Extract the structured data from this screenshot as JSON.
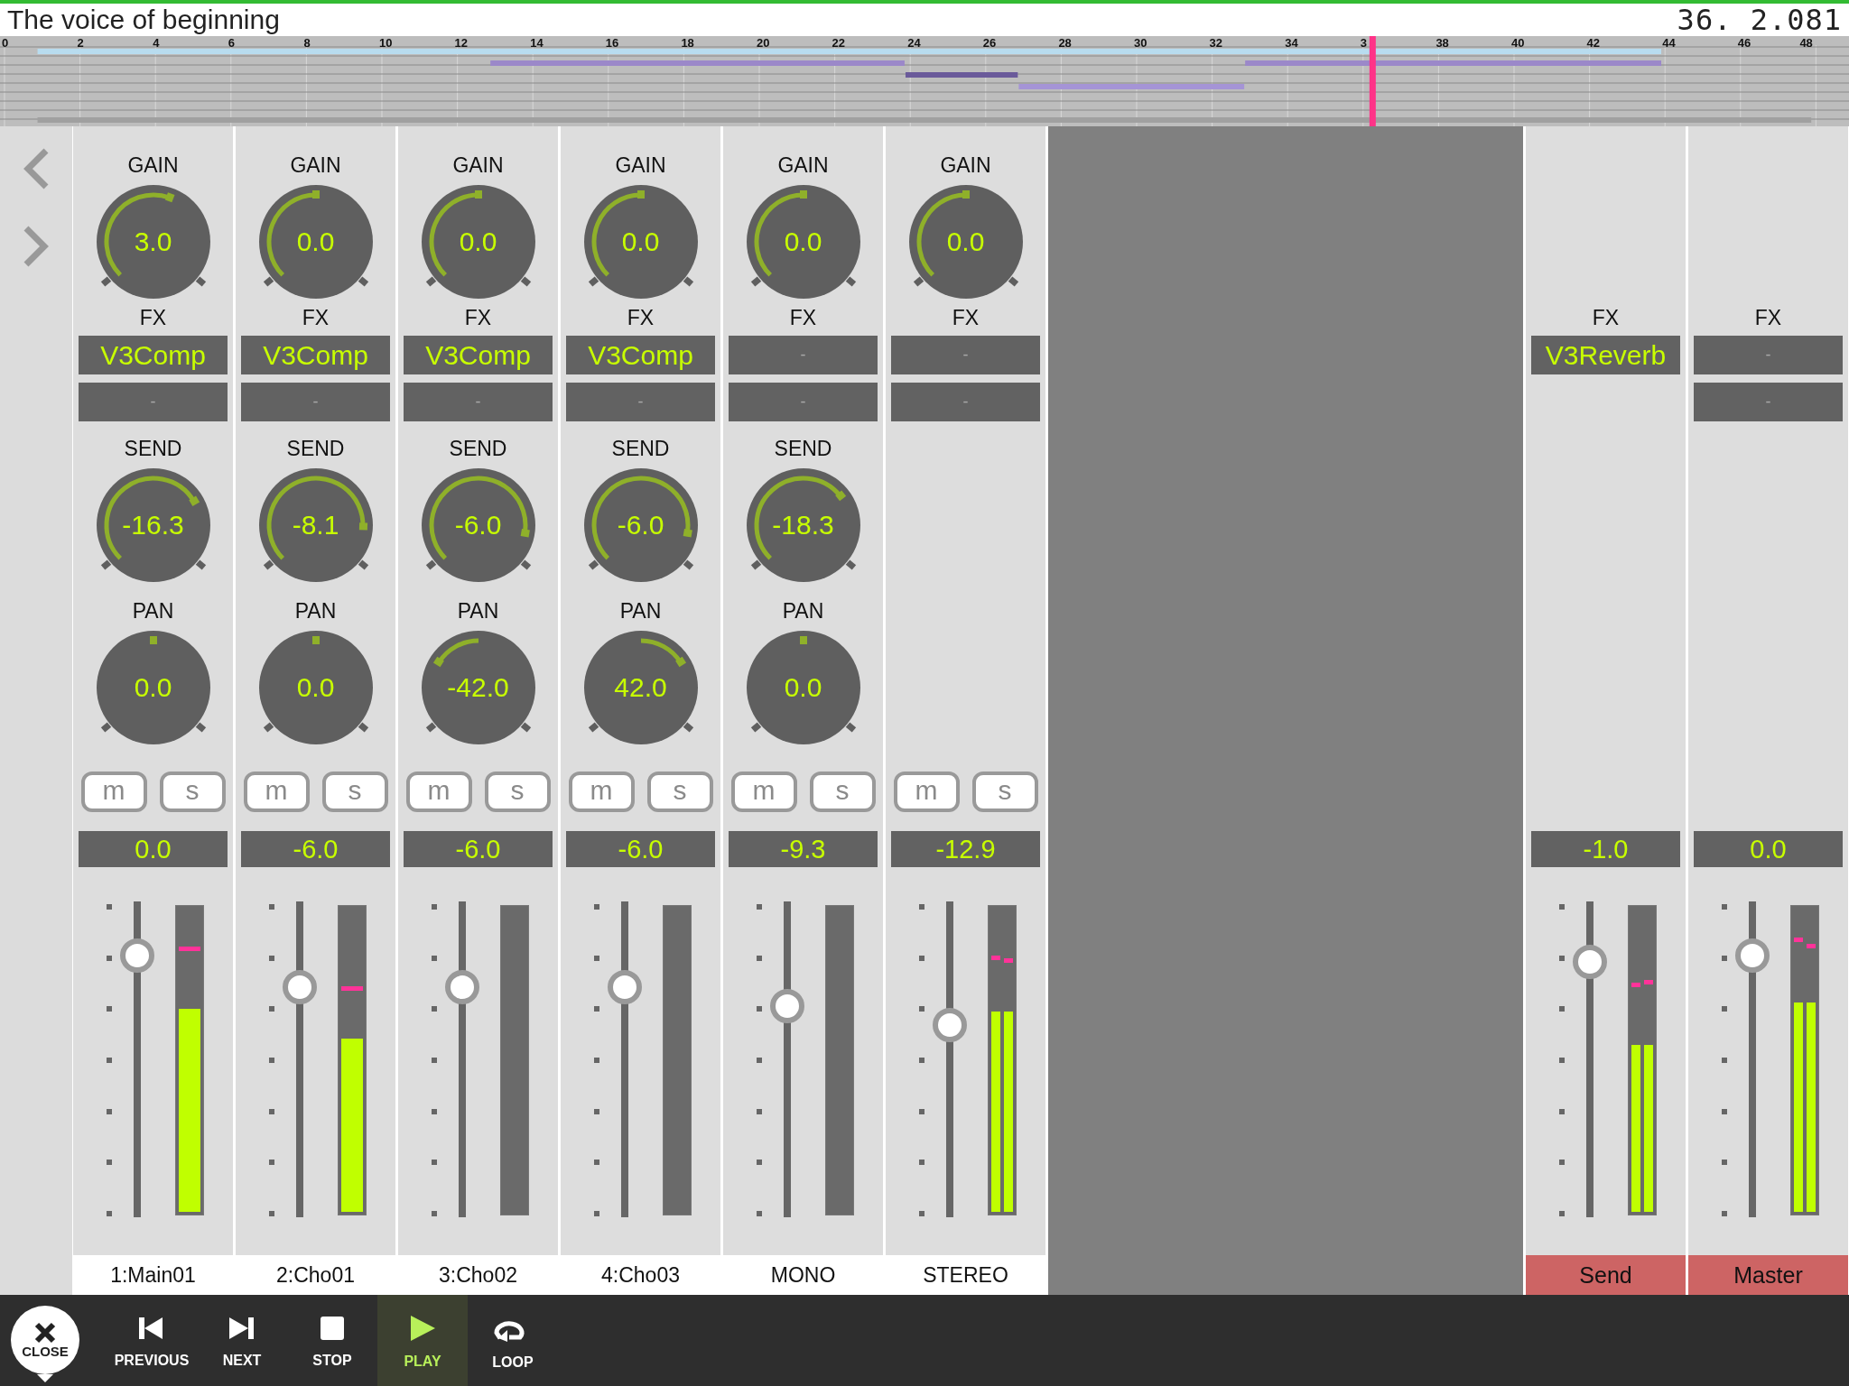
{
  "title": "The voice of beginning",
  "position": "36. 2.081",
  "timeline": {
    "ruler": [
      "0",
      "2",
      "4",
      "6",
      "8",
      "10",
      "12",
      "14",
      "16",
      "18",
      "20",
      "22",
      "24",
      "26",
      "28",
      "30",
      "32",
      "34",
      "3",
      "38",
      "40",
      "42",
      "44",
      "46",
      "48"
    ],
    "playhead": {
      "level": 0.755
    }
  },
  "strips": [
    {
      "name": "1:Main01",
      "kind": "track",
      "gain": {
        "label": "GAIN",
        "value": "3.0"
      },
      "fx_label": "FX",
      "fx": [
        {
          "value": "V3Comp",
          "assigned": true
        },
        {
          "value": "-",
          "assigned": false
        }
      ],
      "send": {
        "label": "SEND",
        "value": "-16.3"
      },
      "pan": {
        "label": "PAN",
        "value": "0.0"
      },
      "mute": {
        "label": "m",
        "on": false
      },
      "solo": {
        "label": "s",
        "on": false
      },
      "volume": "0.0",
      "fader": {
        "level": 0.83
      },
      "meter": [
        {
          "level": 0.67,
          "peak": {
            "level": 0.86
          }
        }
      ]
    },
    {
      "name": "2:Cho01",
      "kind": "track",
      "gain": {
        "label": "GAIN",
        "value": "0.0"
      },
      "fx_label": "FX",
      "fx": [
        {
          "value": "V3Comp",
          "assigned": true
        },
        {
          "value": "-",
          "assigned": false
        }
      ],
      "send": {
        "label": "SEND",
        "value": "-8.1"
      },
      "pan": {
        "label": "PAN",
        "value": "0.0"
      },
      "mute": {
        "label": "m",
        "on": false
      },
      "solo": {
        "label": "s",
        "on": false
      },
      "volume": "-6.0",
      "fader": {
        "level": 0.73
      },
      "meter": [
        {
          "level": 0.57,
          "peak": {
            "level": 0.73
          }
        }
      ]
    },
    {
      "name": "3:Cho02",
      "kind": "track",
      "gain": {
        "label": "GAIN",
        "value": "0.0"
      },
      "fx_label": "FX",
      "fx": [
        {
          "value": "V3Comp",
          "assigned": true
        },
        {
          "value": "-",
          "assigned": false
        }
      ],
      "send": {
        "label": "SEND",
        "value": "-6.0"
      },
      "pan": {
        "label": "PAN",
        "value": "-42.0"
      },
      "mute": {
        "label": "m",
        "on": false
      },
      "solo": {
        "label": "s",
        "on": false
      },
      "volume": "-6.0",
      "fader": {
        "level": 0.73
      }
    },
    {
      "name": "4:Cho03",
      "kind": "track",
      "gain": {
        "label": "GAIN",
        "value": "0.0"
      },
      "fx_label": "FX",
      "fx": [
        {
          "value": "V3Comp",
          "assigned": true
        },
        {
          "value": "-",
          "assigned": false
        }
      ],
      "send": {
        "label": "SEND",
        "value": "-6.0"
      },
      "pan": {
        "label": "PAN",
        "value": "42.0"
      },
      "mute": {
        "label": "m",
        "on": false
      },
      "solo": {
        "label": "s",
        "on": false
      },
      "volume": "-6.0",
      "fader": {
        "level": 0.73
      }
    },
    {
      "name": "MONO",
      "kind": "track",
      "gain": {
        "label": "GAIN",
        "value": "0.0"
      },
      "fx_label": "FX",
      "fx": [
        {
          "value": "-",
          "assigned": false
        },
        {
          "value": "-",
          "assigned": false
        }
      ],
      "send": {
        "label": "SEND",
        "value": "-18.3"
      },
      "pan": {
        "label": "PAN",
        "value": "0.0"
      },
      "mute": {
        "label": "m",
        "on": false
      },
      "solo": {
        "label": "s",
        "on": false
      },
      "volume": "-9.3",
      "fader": {
        "level": 0.67
      }
    },
    {
      "name": "STEREO",
      "kind": "track",
      "gain": {
        "label": "GAIN",
        "value": "0.0"
      },
      "fx_label": "FX",
      "fx": [
        {
          "value": "-",
          "assigned": false
        },
        {
          "value": "-",
          "assigned": false
        }
      ],
      "mute": {
        "label": "m",
        "on": false
      },
      "solo": {
        "label": "s",
        "on": false
      },
      "volume": "-12.9",
      "fader": {
        "level": 0.61
      },
      "meter": [
        {
          "level": 0.66,
          "peak": {
            "level": 0.83
          }
        },
        {
          "level": 0.66,
          "peak": {
            "level": 0.82
          }
        }
      ]
    }
  ],
  "buses": [
    {
      "name": "Send",
      "kind": "bus",
      "fx_label": "FX",
      "fx": [
        {
          "value": "V3Reverb",
          "assigned": true
        }
      ],
      "volume": "-1.0",
      "fader": {
        "level": 0.81
      },
      "meter": [
        {
          "level": 0.55,
          "peak": {
            "level": 0.74
          }
        },
        {
          "level": 0.55,
          "peak": {
            "level": 0.75
          }
        }
      ]
    },
    {
      "name": "Master",
      "kind": "bus",
      "fx_label": "FX",
      "fx": [
        {
          "value": "-",
          "assigned": false
        },
        {
          "value": "-",
          "assigned": false
        }
      ],
      "volume": "0.0",
      "fader": {
        "level": 0.83
      },
      "meter": [
        {
          "level": 0.69,
          "peak": {
            "level": 0.89
          }
        },
        {
          "level": 0.69,
          "peak": {
            "level": 0.87
          }
        }
      ]
    }
  ],
  "close": {
    "label": "CLOSE"
  },
  "transport": [
    {
      "kind": "previous",
      "label": "PREVIOUS",
      "selected": false
    },
    {
      "kind": "next",
      "label": "NEXT",
      "selected": false
    },
    {
      "kind": "stop",
      "label": "STOP",
      "selected": false
    },
    {
      "kind": "play",
      "label": "PLAY",
      "selected": true
    },
    {
      "kind": "loop",
      "label": "LOOP",
      "selected": false
    }
  ]
}
